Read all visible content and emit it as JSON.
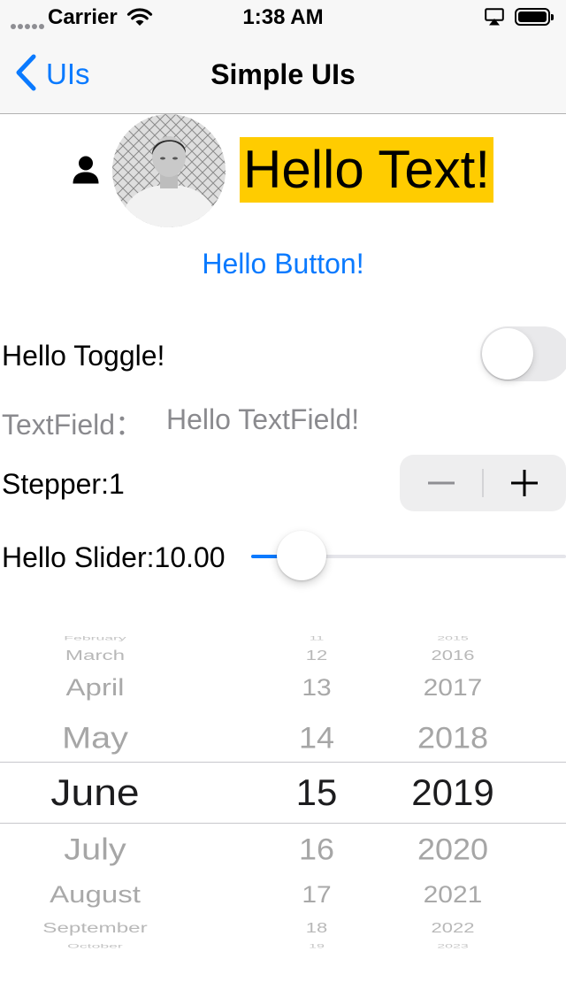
{
  "status_bar": {
    "carrier": "Carrier",
    "time": "1:38 AM"
  },
  "nav": {
    "back_label": "UIs",
    "title": "Simple UIs"
  },
  "header": {
    "hello_text": "Hello Text!",
    "hello_text_bg": "#ffcc00"
  },
  "hello_button": "Hello Button!",
  "toggle": {
    "label": "Hello Toggle!",
    "on": false
  },
  "text_field": {
    "label": "TextField：",
    "placeholder": "Hello TextField!",
    "value": ""
  },
  "stepper": {
    "label": "Stepper:1",
    "value": 1
  },
  "slider": {
    "label": "Hello Slider:10.00",
    "value": 10.0,
    "fraction": 0.16
  },
  "date_picker": {
    "months": [
      "February",
      "March",
      "April",
      "May",
      "June",
      "July",
      "August",
      "September",
      "October"
    ],
    "days": [
      "11",
      "12",
      "13",
      "14",
      "15",
      "16",
      "17",
      "18",
      "19"
    ],
    "years": [
      "2015",
      "2016",
      "2017",
      "2018",
      "2019",
      "2020",
      "2021",
      "2022",
      "2023"
    ],
    "selected_index": 4,
    "selected": {
      "month": "June",
      "day": "15",
      "year": "2019"
    }
  },
  "colors": {
    "accent": "#0a7aff",
    "nav_background": "#f7f7f7"
  }
}
